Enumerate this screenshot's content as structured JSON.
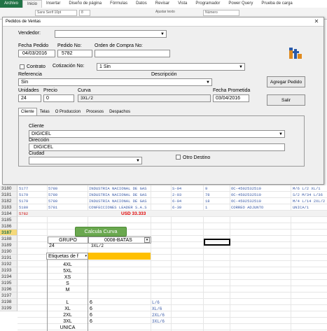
{
  "ribbon": {
    "tabs": [
      "Archivo",
      "Inicio",
      "Insertar",
      "Diseño de página",
      "Fórmulas",
      "Datos",
      "Revisar",
      "Vista",
      "Programador",
      "Power Query",
      "Prueba de carga"
    ],
    "font_name": "Sans Serif 10pt",
    "font_size": "8",
    "wrap_label": "Ajustar texto",
    "number_format": "Número"
  },
  "dialog": {
    "title": "Pedidos de Ventas",
    "vendedor_label": "Vendedor:",
    "vendedor_value": "",
    "fecha_label": "Fecha Pedido",
    "fecha_value": "04/03/2016",
    "pedido_no_label": "Pedido No:",
    "pedido_no_value": "5782",
    "orden_label": "Orden de Compra No:",
    "orden_value": "",
    "contrato_label": "Contrato",
    "cotizacion_label": "Cotización No:",
    "cotizacion_value": "1 Sin",
    "referencia_label": "Referencia",
    "descripcion_label": "Descripción",
    "referencia_value": "Sin",
    "agregar_label": "Agregar Pedido",
    "salir_label": "Salir",
    "unidades_label": "Unidades",
    "unidades_value": "24",
    "precio_label": "Precio",
    "precio_value": "0",
    "curva_label": "Curva",
    "curva_value": "3XL/2",
    "fecha_prometida_label": "Fecha Prometida",
    "fecha_prometida_value": "03/04/2016",
    "tabs": [
      "Cliente",
      "Telas",
      "O Produccion",
      "Procesos",
      "Despachos"
    ],
    "cliente_label": "Cliente",
    "cliente_value": "DIGICEL",
    "direccion_label": "Dirección",
    "direccion_value": "DIGICEL",
    "ciudad_label": "Ciudad",
    "ciudad_value": "",
    "otro_destino_label": "Otro Destino"
  },
  "sheet": {
    "rows": [
      {
        "num": "3180",
        "c1": "5177",
        "c2": "5780",
        "c3": "INDUSTRIA NACIONAL DE GAS",
        "c4": "S-04",
        "c5": "9",
        "c6": "OC-4502532510",
        "c7": "M/6 L/2 XL/1"
      },
      {
        "num": "3181",
        "c1": "5179",
        "c2": "5780",
        "c3": "INDUSTRIA NACIONAL DE GAS",
        "c4": "2-03",
        "c5": "78",
        "c6": "OC-4502532510",
        "c7": "S/2 M/34 L/36"
      },
      {
        "num": "3182",
        "c1": "5179",
        "c2": "5780",
        "c3": "INDUSTRIA NACIONAL DE GAS",
        "c4": "6-04",
        "c5": "18",
        "c6": "OC-4502532510",
        "c7": "M/4 L/14 2XL/2"
      },
      {
        "num": "3183",
        "c1": "5180",
        "c2": "5781",
        "c3": "CONFECCIONES LEADER S.A.S",
        "c4": "6-39",
        "c5": "1",
        "c6": "CORREO ADJUNTO",
        "c7": "UNICA/1"
      },
      {
        "num": "3184",
        "c1": "5782",
        "c2": "",
        "c3": "",
        "c4": "",
        "c5": "",
        "c6": "",
        "c7": ""
      }
    ],
    "total": "USD 33.333",
    "calc_button": "Calcula Curva",
    "grupo_label": "GRUPO",
    "grupo_value": "0008-BATAS",
    "qty": "24",
    "curve": "3XL/2",
    "pivot_header": "Etiquetas de f",
    "sizes": [
      "4XL",
      "5XL",
      "XS",
      "S",
      "M",
      "L",
      "XL",
      "2XL",
      "3XL",
      "UNICA"
    ],
    "size_values": [
      "",
      "",
      "",
      "",
      "",
      "6",
      "6",
      "6",
      "6",
      ""
    ],
    "size_curves": [
      "",
      "",
      "",
      "",
      "",
      "L/6",
      "XL/6",
      "2XL/6",
      "3XL/6",
      ""
    ],
    "rownums": [
      "3185",
      "3186",
      "3187",
      "3188",
      "3189",
      "3190",
      "3191",
      "3192",
      "3193",
      "3194",
      "3195",
      "3196",
      "3197",
      "3198",
      "3199"
    ]
  }
}
